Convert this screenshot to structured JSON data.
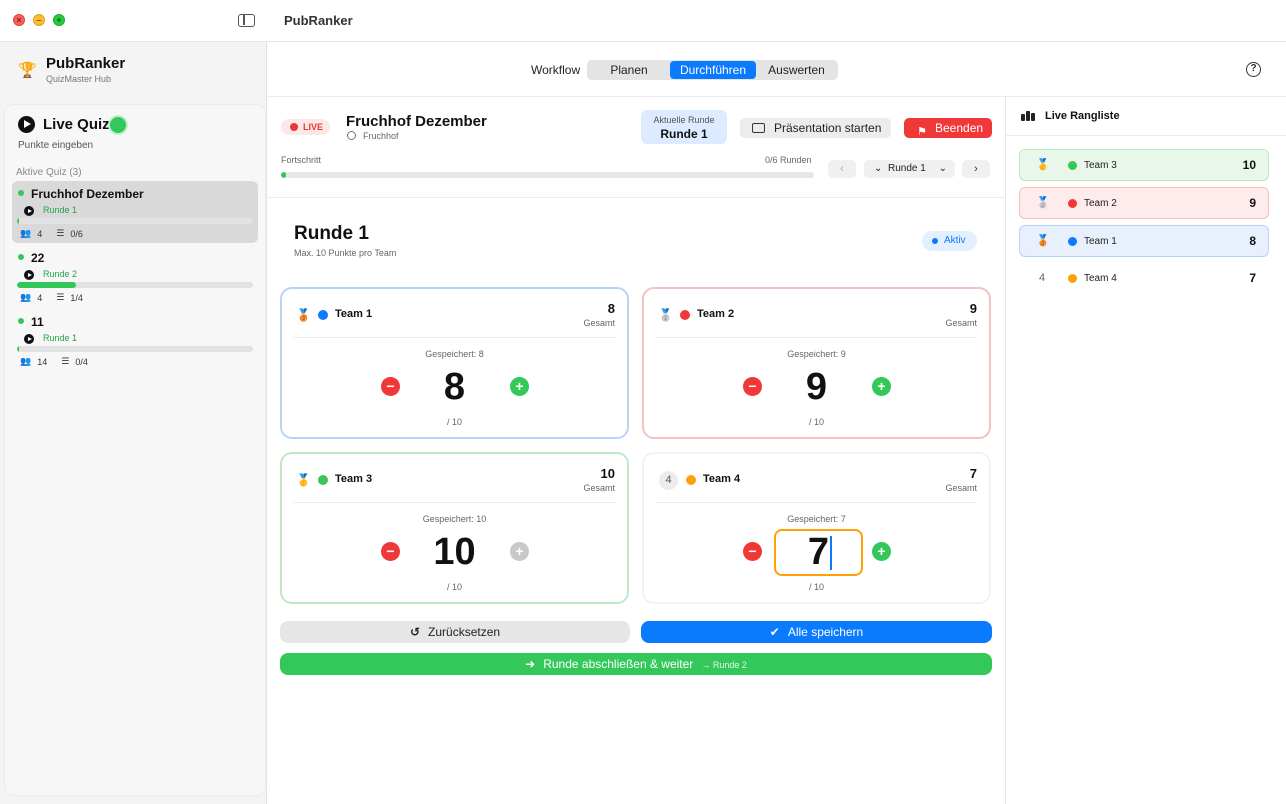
{
  "window": {
    "title": "PubRanker"
  },
  "brand": {
    "name": "PubRanker",
    "subtitle": "QuizMaster Hub"
  },
  "toolbar": {
    "workflow_label": "Workflow",
    "segments": [
      {
        "label": "Planen",
        "active": false
      },
      {
        "label": "Durchführen",
        "active": true
      },
      {
        "label": "Auswerten",
        "active": false
      }
    ],
    "help_label": "?"
  },
  "sidebar": {
    "title": "Live Quiz",
    "subtitle": "Punkte eingeben",
    "section_label": "Aktive Quiz (3)",
    "quizzes": [
      {
        "name": "Fruchhof Dezember",
        "round": "Runde 1",
        "teams": "4",
        "rounds": "0/6",
        "progress": 0.0,
        "selected": true
      },
      {
        "name": "22",
        "round": "Runde 2",
        "teams": "4",
        "rounds": "1/4",
        "progress": 0.25,
        "selected": false
      },
      {
        "name": "11",
        "round": "Runde 1",
        "teams": "14",
        "rounds": "0/4",
        "progress": 0.0,
        "selected": false
      }
    ]
  },
  "header": {
    "live_label": "LIVE",
    "quiz_title": "Fruchhof Dezember",
    "venue": "Fruchhof",
    "current_round_label": "Aktuelle Runde",
    "current_round_value": "Runde 1",
    "present_button": "Präsentation starten",
    "end_button": "Beenden",
    "progress_label": "Fortschritt",
    "progress_count": "0/6 Runden",
    "progress": 0.0,
    "round_select": "Runde 1",
    "prev_icon": "‹",
    "next_icon": "›"
  },
  "round": {
    "title": "Runde 1",
    "subtitle": "Max. 10 Punkte pro Team",
    "status": "Aktiv"
  },
  "teams": [
    {
      "name": "Team 1",
      "color": "#0a7aff",
      "total": "8",
      "total_label": "Gesamt",
      "saved": "Gespeichert: 8",
      "score": "8",
      "max": "/ 10",
      "medal": "bronze"
    },
    {
      "name": "Team 2",
      "color": "#f03838",
      "total": "9",
      "total_label": "Gesamt",
      "saved": "Gespeichert: 9",
      "score": "9",
      "max": "/ 10",
      "medal": "silver"
    },
    {
      "name": "Team 3",
      "color": "#34c759",
      "total": "10",
      "total_label": "Gesamt",
      "saved": "Gespeichert: 10",
      "score": "10",
      "max": "/ 10",
      "medal": "gold"
    },
    {
      "name": "Team 4",
      "color": "#ff9f0a",
      "total": "7",
      "total_label": "Gesamt",
      "saved": "Gespeichert: 7",
      "score": "7",
      "max": "/ 10",
      "rank": "4"
    }
  ],
  "actions": {
    "reset": "Zurücksetzen",
    "save_all": "Alle speichern",
    "finish": "Runde abschließen & weiter",
    "finish_next": "→ Runde 2"
  },
  "ranking": {
    "title": "Live Rangliste",
    "rows": [
      {
        "name": "Team 3",
        "score": "10",
        "color": "#34c759",
        "medal": "gold"
      },
      {
        "name": "Team 2",
        "score": "9",
        "color": "#f03838",
        "medal": "silver"
      },
      {
        "name": "Team 1",
        "score": "8",
        "color": "#0a7aff",
        "medal": "bronze"
      },
      {
        "name": "Team 4",
        "score": "7",
        "color": "#ff9f0a",
        "rank": "4"
      }
    ]
  }
}
